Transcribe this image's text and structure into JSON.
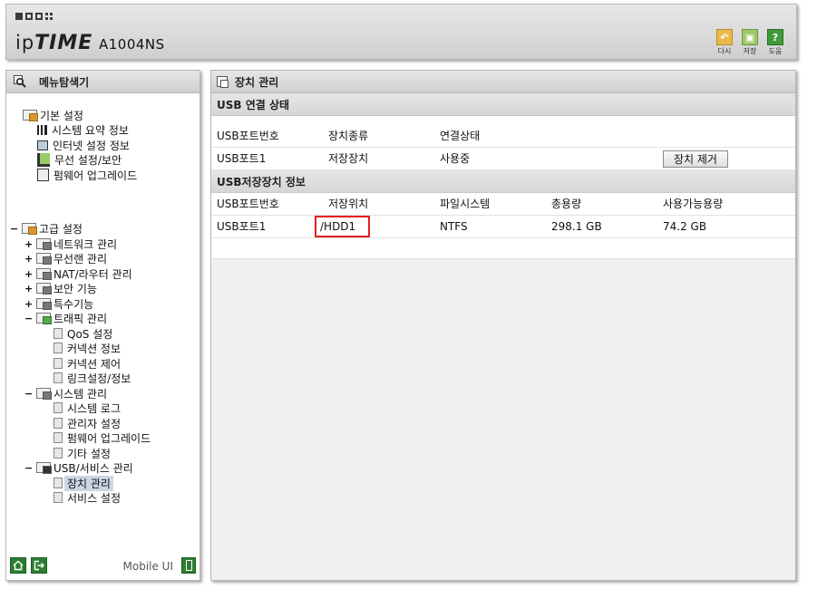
{
  "header": {
    "brand_ip": "ip",
    "brand_time": "TIME",
    "model": "A1004NS",
    "tools": [
      {
        "label": "다시",
        "icon": "undo-icon"
      },
      {
        "label": "저장",
        "icon": "save-icon"
      },
      {
        "label": "도움",
        "icon": "help-icon"
      }
    ]
  },
  "left": {
    "title": "메뉴탐색기",
    "basic": {
      "label": "기본 설정",
      "items": [
        "시스템 요약 정보",
        "인터넷 설정 정보",
        "무선 설정/보안",
        "펌웨어 업그레이드"
      ]
    },
    "advanced": {
      "label": "고급 설정",
      "expander": "−",
      "groups": [
        {
          "label": "네트워크 관리",
          "expander": "+"
        },
        {
          "label": "무선랜 관리",
          "expander": "+"
        },
        {
          "label": "NAT/라우터 관리",
          "expander": "+"
        },
        {
          "label": "보안 기능",
          "expander": "+"
        },
        {
          "label": "특수기능",
          "expander": "+"
        },
        {
          "label": "트래픽 관리",
          "expander": "−",
          "children": [
            "QoS 설정",
            "커넥션 정보",
            "커넥션 제어",
            "링크설정/정보"
          ]
        },
        {
          "label": "시스템 관리",
          "expander": "−",
          "children": [
            "시스템 로그",
            "관리자 설정",
            "펌웨어 업그레이드",
            "기타 설정"
          ]
        },
        {
          "label": "USB/서비스 관리",
          "expander": "−",
          "children": [
            "장치 관리",
            "서비스 설정"
          ]
        }
      ]
    },
    "footer": {
      "mobile_label": "Mobile UI"
    }
  },
  "main": {
    "title": "장치 관리",
    "usb_status": {
      "title": "USB 연결 상태",
      "columns": [
        "USB포트번호",
        "장치종류",
        "연결상태"
      ],
      "rows": [
        {
          "port": "USB포트1",
          "type": "저장장치",
          "state": "사용중",
          "action": "장치 제거"
        }
      ]
    },
    "storage": {
      "title": "USB저장장치 정보",
      "columns": [
        "USB포트번호",
        "저장위치",
        "파일시스템",
        "총용량",
        "사용가능용량"
      ],
      "rows": [
        {
          "port": "USB포트1",
          "location": "/HDD1",
          "fs": "NTFS",
          "total": "298.1 GB",
          "free": "74.2 GB"
        }
      ]
    }
  },
  "colors": {
    "highlight": "#e02020",
    "accent_green": "#2e7d32"
  }
}
